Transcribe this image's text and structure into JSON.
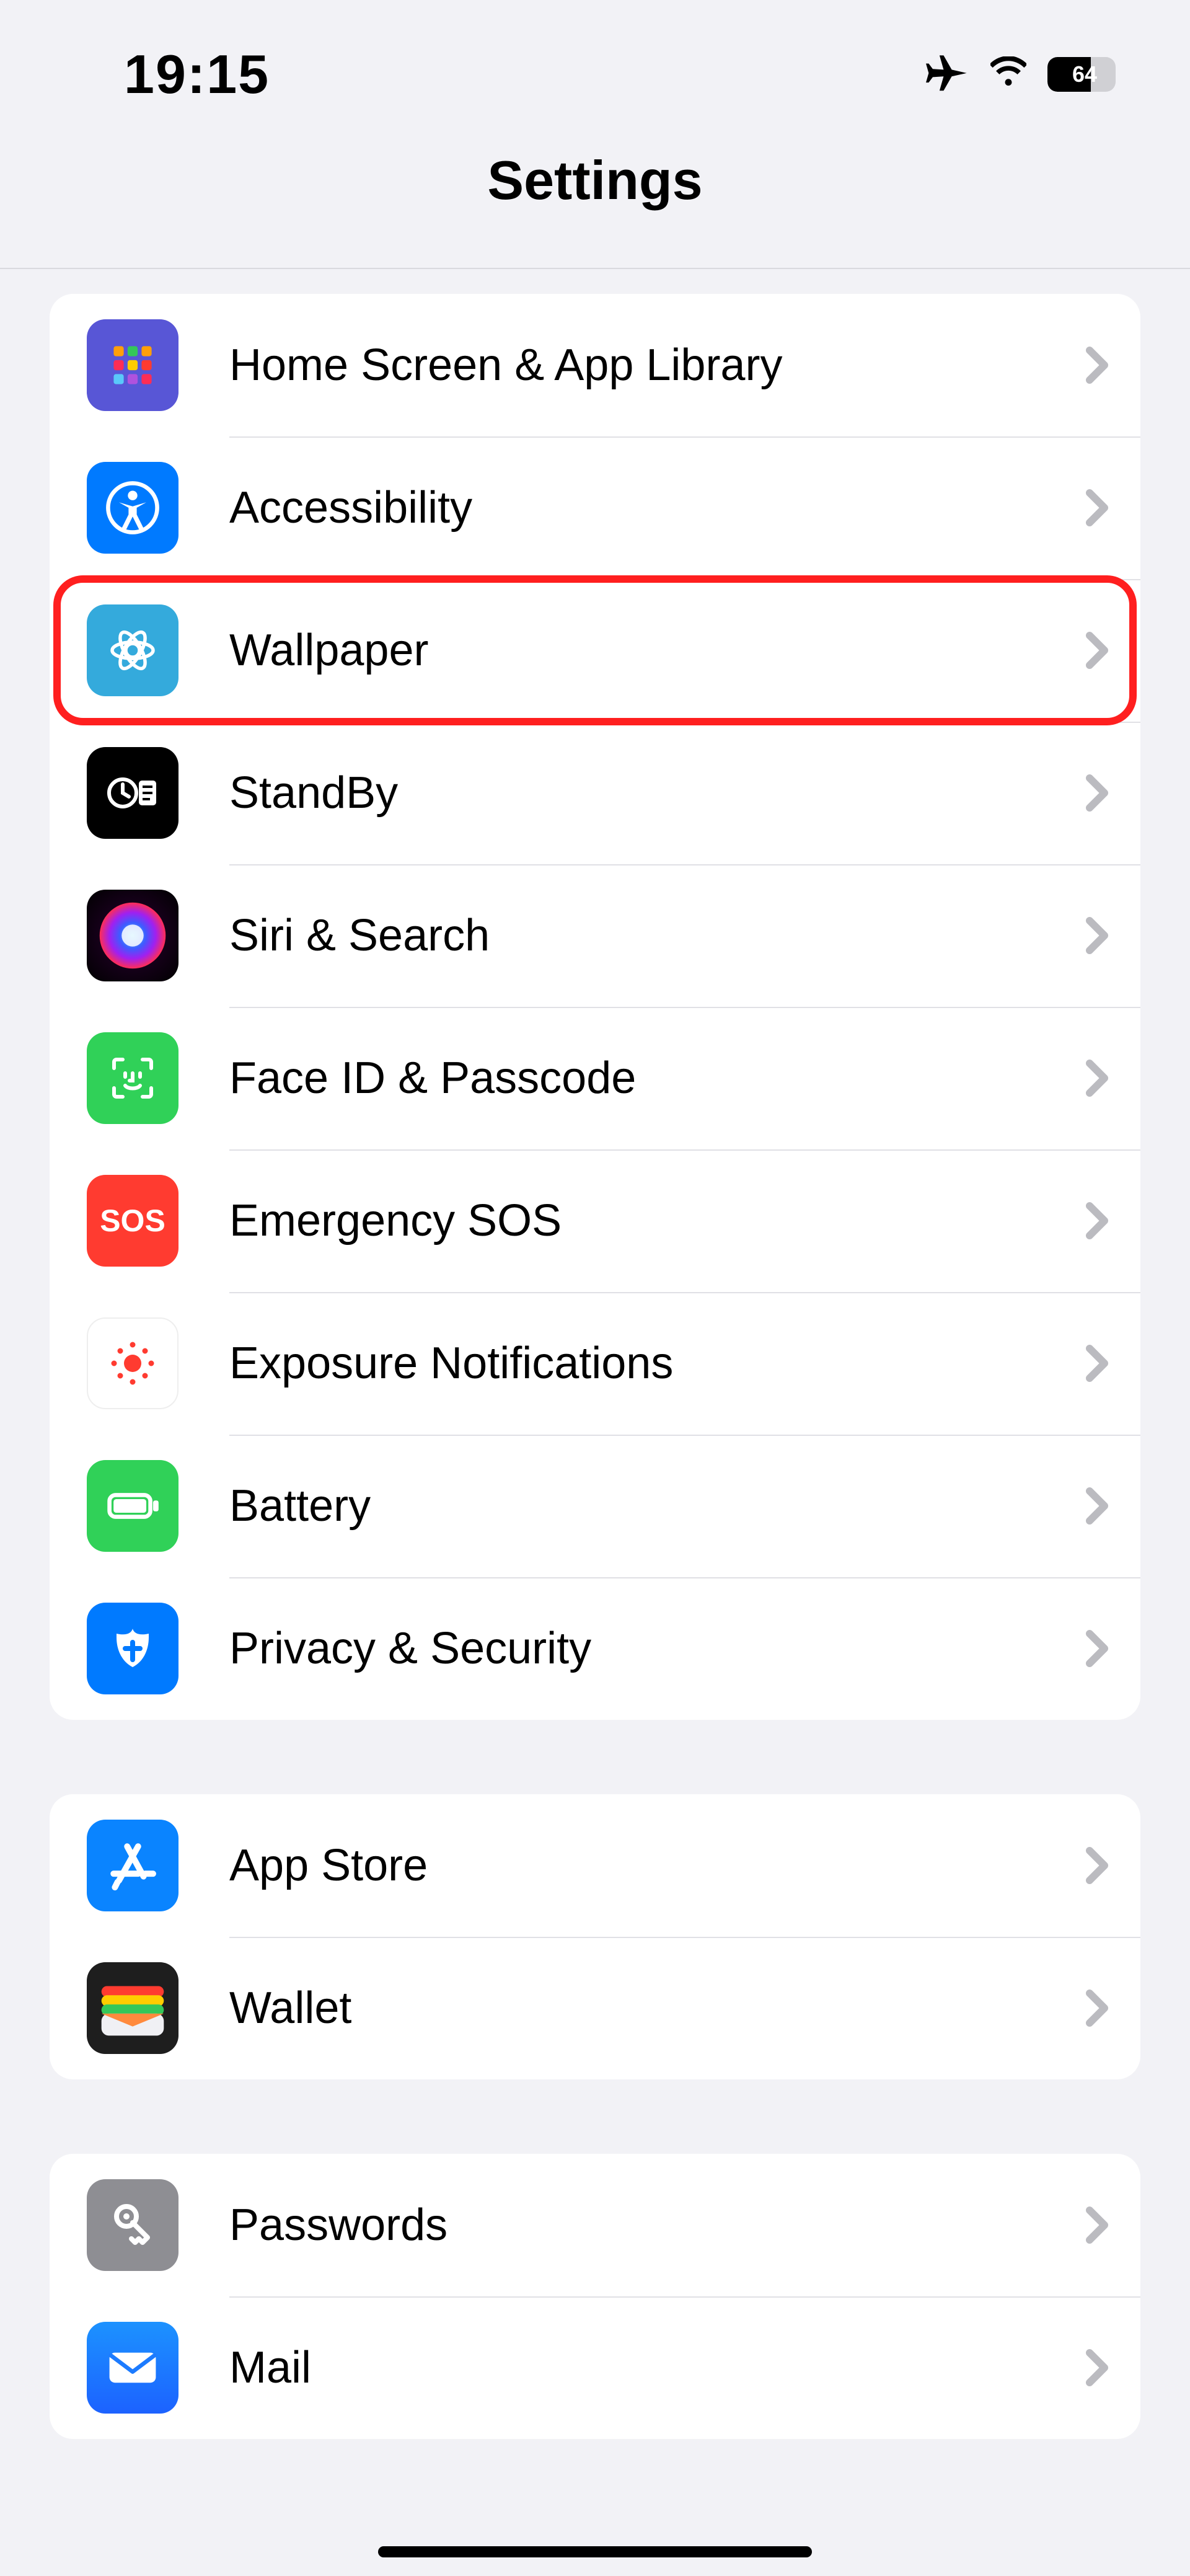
{
  "status": {
    "time": "19:15",
    "battery_level": "64"
  },
  "title": "Settings",
  "group1": {
    "rows": [
      {
        "label": "Home Screen & App Library"
      },
      {
        "label": "Accessibility"
      },
      {
        "label": "Wallpaper"
      },
      {
        "label": "StandBy"
      },
      {
        "label": "Siri & Search"
      },
      {
        "label": "Face ID & Passcode"
      },
      {
        "label": "Emergency SOS"
      },
      {
        "label": "Exposure Notifications"
      },
      {
        "label": "Battery"
      },
      {
        "label": "Privacy & Security"
      }
    ],
    "sos_text": "SOS"
  },
  "group2": {
    "rows": [
      {
        "label": "App Store"
      },
      {
        "label": "Wallet"
      }
    ]
  },
  "group3": {
    "rows": [
      {
        "label": "Passwords"
      },
      {
        "label": "Mail"
      }
    ]
  }
}
